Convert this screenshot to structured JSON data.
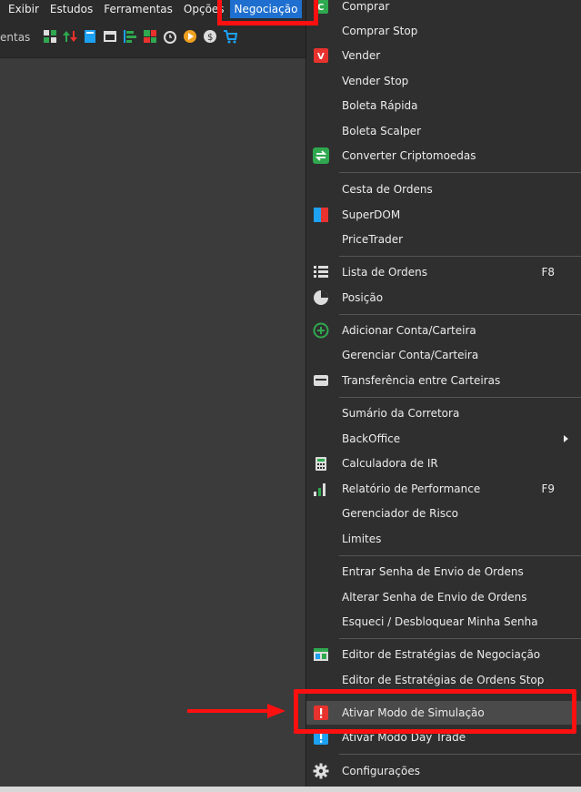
{
  "menubar": {
    "items": [
      "Exibir",
      "Estudos",
      "Ferramentas",
      "Opções",
      "Negociação"
    ]
  },
  "toolbar": {
    "label": "entas",
    "icons": [
      "layout-icon",
      "arrows-updown-icon",
      "book-icon",
      "window-icon",
      "ladder-icon",
      "grid-icon",
      "alarm-icon",
      "replay-icon",
      "coin-icon",
      "cart-icon"
    ]
  },
  "menu": {
    "items": [
      {
        "label": "Comprar",
        "icon": "buy-icon"
      },
      {
        "label": "Comprar Stop",
        "icon": ""
      },
      {
        "label": "Vender",
        "icon": "sell-icon"
      },
      {
        "label": "Vender Stop",
        "icon": ""
      },
      {
        "label": "Boleta Rápida",
        "icon": ""
      },
      {
        "label": "Boleta Scalper",
        "icon": ""
      },
      {
        "label": "Converter Criptomoedas",
        "icon": "convert-icon"
      },
      {
        "label": "Cesta de Ordens",
        "icon": ""
      },
      {
        "label": "SuperDOM",
        "icon": "superdom-icon"
      },
      {
        "label": "PriceTrader",
        "icon": ""
      },
      {
        "label": "Lista de Ordens",
        "icon": "list-icon",
        "shortcut": "F8"
      },
      {
        "label": "Posição",
        "icon": "pie-chart-icon"
      },
      {
        "label": "Adicionar Conta/Carteira",
        "icon": "add-circle-icon"
      },
      {
        "label": "Gerenciar Conta/Carteira",
        "icon": ""
      },
      {
        "label": "Transferência entre Carteiras",
        "icon": "wallet-icon"
      },
      {
        "label": "Sumário da Corretora",
        "icon": ""
      },
      {
        "label": "BackOffice",
        "icon": "",
        "submenu": true
      },
      {
        "label": "Calculadora de IR",
        "icon": "calculator-icon"
      },
      {
        "label": "Relatório de Performance",
        "icon": "bar-chart-icon",
        "shortcut": "F9"
      },
      {
        "label": "Gerenciador de Risco",
        "icon": ""
      },
      {
        "label": "Limites",
        "icon": ""
      },
      {
        "label": "Entrar Senha de Envio de Ordens",
        "icon": ""
      },
      {
        "label": "Alterar Senha de Envio de Ordens",
        "icon": ""
      },
      {
        "label": "Esqueci / Desbloquear Minha Senha",
        "icon": ""
      },
      {
        "label": "Editor de Estratégias de Negociação",
        "icon": "strategy-editor-icon"
      },
      {
        "label": "Editor de Estratégias de Ordens Stop",
        "icon": ""
      },
      {
        "label": "Ativar Modo de Simulação",
        "icon": "simulation-alert-icon"
      },
      {
        "label": "Ativar Modo Day Trade",
        "icon": "daytrade-alert-icon"
      },
      {
        "label": "Configurações",
        "icon": "gear-icon"
      }
    ]
  },
  "colors": {
    "highlight": "#ff1010",
    "active_menu": "#1e6fcf"
  }
}
